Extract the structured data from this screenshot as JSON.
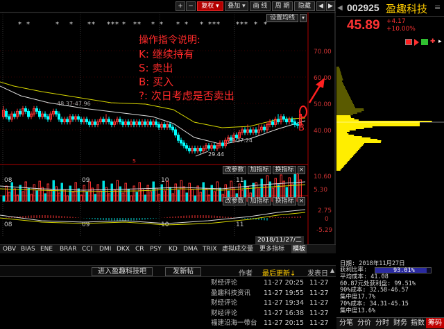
{
  "toolbar": {
    "plus": "+",
    "minus": "−",
    "fuquan": "复权 ▾",
    "diejia": "叠加 ▾",
    "huaxian": "画 线",
    "zhouqi": "周 期",
    "yincang": "隐藏",
    "prev": "◀",
    "next": "▶"
  },
  "stock": {
    "code": "002925",
    "name": "盈趣科技",
    "price": "45.89",
    "change": "+4.17",
    "change_pct": "+10.00%"
  },
  "settings_label": "设置均线",
  "price_axis": [
    "70.00",
    "60.00",
    "50.00",
    "40.00"
  ],
  "volume_axis": [
    "10.60",
    "5.30"
  ],
  "macd_axis": [
    "2.75",
    "-5.29"
  ],
  "macd_zero": "0",
  "month_labels": [
    "08",
    "09",
    "10",
    "11"
  ],
  "date_marker": "2018/11/27/二",
  "ma_label_high": "48.37-47.96",
  "ma_label_low": "22-37.24",
  "low_label": "29.44",
  "b_marker": "B",
  "red_s": "s",
  "indicator_buttons": {
    "vol": [
      "改参数",
      "加指标",
      "换指标"
    ],
    "macd": [
      "改参数",
      "加指标",
      "换指标"
    ]
  },
  "note": {
    "title": "操作指令说明:",
    "lines": [
      "K:  继续持有",
      "S:  卖出",
      "B:  买入",
      "?:  次日考虑是否卖出"
    ]
  },
  "tabs": [
    "OBV",
    "BIAS",
    "ENE",
    "BRAR",
    "CCI",
    "DMI",
    "DKX",
    "CR",
    "PSY",
    "KD",
    "DMA",
    "TRIX",
    "虚拟成交量",
    "更多指标",
    "模板"
  ],
  "news_header": {
    "btn1": "进入盈趣科技吧",
    "btn2": "发新帖",
    "col_author": "作者",
    "col_updated": "最后更新↓",
    "col_posted": "发表日"
  },
  "news": [
    {
      "author": "财经评论",
      "time": "11-27 20:25",
      "posted": "11-27"
    },
    {
      "author": "盈趣科技资讯",
      "time": "11-27 19:55",
      "posted": "11-27"
    },
    {
      "author": "财经评论",
      "time": "11-27 19:34",
      "posted": "11-27"
    },
    {
      "author": "财经评论",
      "time": "11-27 16:38",
      "posted": "11-27"
    },
    {
      "author": "福建沿海一带台",
      "time": "11-27 20:15",
      "posted": "11-27"
    }
  ],
  "chip_stats": {
    "date": "日期: 2018年11月27日",
    "profit_label": "获利比率:",
    "profit_value": "93.01%",
    "avg_cost": "平均成本: 41.08",
    "profit_at": "60.87元处获利盘: 99.51%",
    "cost90": "90%成本: 32.58-46.57",
    "conc90": "集中度17.7%",
    "cost70": "70%成本: 34.31-45.15",
    "conc70": "集中度13.6%"
  },
  "bottom_tabs": [
    "分笔",
    "分价",
    "分时",
    "财务",
    "指数",
    "筹码"
  ],
  "colors": {
    "up": "#ff3333",
    "down": "#00ffff",
    "yellow": "#ffff00",
    "note": "#ff2a2a"
  }
}
